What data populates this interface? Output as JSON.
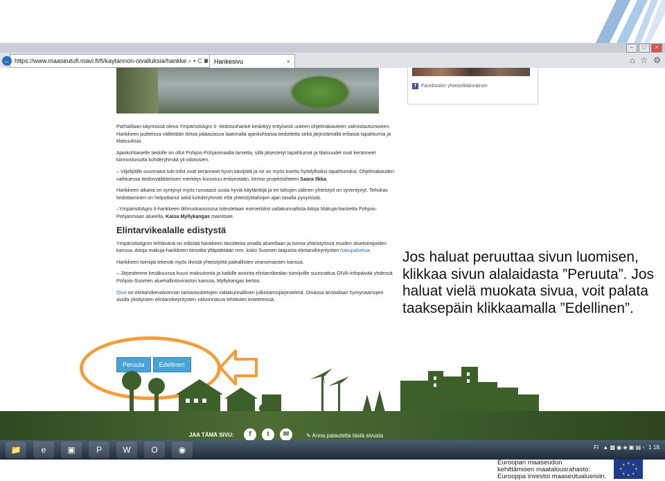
{
  "browser": {
    "url": "https://www.maaseutufi.mavi.fi/fi/kaytannon-oivalluksia/hankke",
    "url_controls": "⌕ ▾ C ✖",
    "tab_title": "Hankesivu",
    "tab_close": "×",
    "window_buttons": [
      "–",
      "□",
      "×"
    ]
  },
  "sidebar": {
    "facebook_link": "Facebookin yhteisöliitännäinen"
  },
  "article": {
    "paragraphs": [
      "Parhaillaan käynnissä oleva YmpäristöAgro II -tiedotushanke keskittyy erityisesti uuteen ohjelmakauteen valmistautumiseen. Hankkeen puitteissa välitetään tietoa pääasiassa laatimalla ajankohtaisia tiedotteita sekä järjestämällä erilaisia tapahtumia ja tilaisuuksia.",
      "Ajankohtaiselle tiedolle on ollut Pohjois-Pohjanmaalla tarvetta, sillä järjestetyt tapahtumat ja tilaisuudet ovat keränneet kiinnostunutta kohderyhmää yli odotusten.",
      "– Viljelijöille suunnatut tuki-infot ovat keränneet hyvin kävijöitä ja ne on myös koettu hyödyllisiksi tapahtumiksi. Ohjelmakauden vaihtuessa tiedonvälittämisen merkitys korostuu entisestään, kertoo projektisihteeri",
      "Hankkeen aikana on syntynyt myös runsaasti uusia hyviä käytäntöjä ja eri tahojen välinen yhteistyö on syventynyt. Tehokas tiedottaminen on helpottanut sekä kohderyhmän että yhteistyötahojen ajan tasalla pysymistä.",
      "–YmpäristöAgro II-hankkeen lähiruokaosiossa toteutetaan esimerkiksi valtakunnallista Aitoja Makuja-hanketta Pohjois-Pohjanmaan alueella,"
    ],
    "name_saara": "Saara Ilkka",
    "name_kaisa": "Kaisa Myllykangas",
    "mentions_suffix": " mainitsee.",
    "heading": "Elintarvikealalle edistystä",
    "paragraphs2": [
      "YmpäristöAgron tehtävänä on edistää hankkeen tavoitteita omalla alueellaan ja toimia yhteistyössä muiden aluetoimijoiden kanssa. Aitoja makuja-hankkeen tiimoilta ylläpidetään mm. koko Suomen laajuista elintarvikeyritysten",
      "Hankkeen toimijat tekevät myös tiivistä yhteistyötä paikallisten viranomaisten kanssa.",
      "– Järjestimme kesäkuussa kuusi maksutonta ja kaikille avointa elintarvikealan toimijoille suunnattua OIVA-infopäivää yhdessä Pohjois-Suomen aluehallintoviraston kanssa, Myllykangas kertoo."
    ],
    "link_haku": "hakupalvelua",
    "oiva_link": "Oiva",
    "oiva_text": " on elintarvikevalvonnan tarkastustietojen valtakunnallinen julkistamisjärjestelmä. Oivassa arvioidaan hymynaamojen avulla yksityisten elintarvikeyritysten valvonnassa tehtävien kriteereissä."
  },
  "buttons": {
    "cancel": "Peruuta",
    "previous": "Edellinen"
  },
  "footer": {
    "share_label": "JAA TÄMÄ SIVU:",
    "feedback": "Anna palautetta tästä sivusta"
  },
  "taskbar": {
    "lang": "FI",
    "clock": "18.",
    "clock_top": "1"
  },
  "eu": {
    "line1": "Euroopan maaseudun",
    "line2": "kehittämisen maatalousrahasto:",
    "line3": "Eurooppa investoi maaseutualueisiin."
  },
  "caption": {
    "text": "Jos haluat peruuttaa sivun luomisen, klikkaa sivun alalaidasta ”Peruuta”. Jos haluat vielä muokata sivua, voit palata taaksepäin klikkaamalla ”Edellinen”."
  },
  "colors": {
    "accent_button": "#4aa3d6",
    "highlight": "#f39c3a",
    "footer_green": "#3d5f2a"
  }
}
